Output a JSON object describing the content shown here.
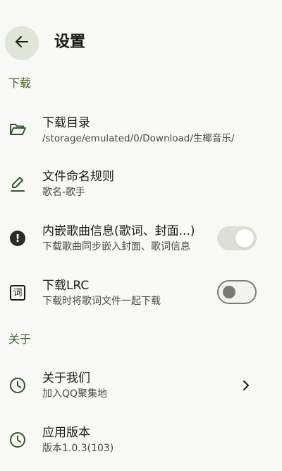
{
  "header": {
    "title": "设置",
    "back_icon": "arrow-left-icon"
  },
  "sections": {
    "download": "下载",
    "about": "关于"
  },
  "items": {
    "download_dir": {
      "title": "下载目录",
      "subtitle": "/storage/emulated/0/Download/生椰音乐/",
      "icon": "folder-open-icon"
    },
    "file_naming": {
      "title": "文件命名规则",
      "subtitle": "歌名-歌手",
      "icon": "pencil-icon"
    },
    "embed_info": {
      "title": "内嵌歌曲信息(歌词、封面...)",
      "subtitle": "下载歌曲同步嵌入封面、歌词信息",
      "icon": "info-icon",
      "enabled": true
    },
    "download_lrc": {
      "title": "下载LRC",
      "subtitle": "下载时将歌词文件一起下载",
      "icon": "lyrics-icon",
      "icon_glyph": "词",
      "enabled": false
    },
    "about_us": {
      "title": "关于我们",
      "subtitle": "加入QQ聚集地",
      "icon": "clock-icon"
    },
    "app_version": {
      "title": "应用版本",
      "subtitle": "版本1.0.3(103)",
      "icon": "clock-icon"
    }
  },
  "colors": {
    "accent": "#3c6b2e",
    "icon_green": "#2e5b28",
    "back_button_bg": "#dfe6d7",
    "background": "#f8f8f5"
  }
}
